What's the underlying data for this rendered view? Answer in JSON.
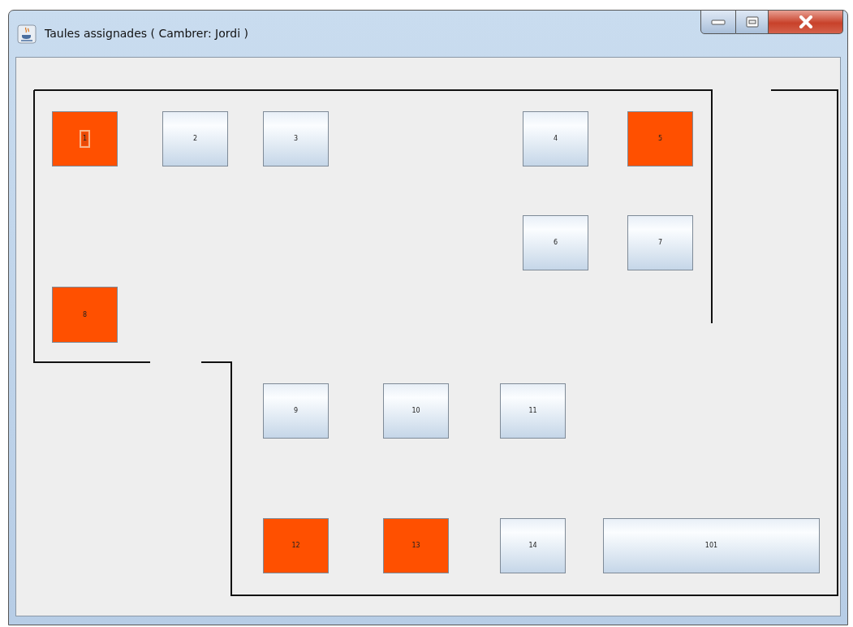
{
  "window": {
    "title": "Taules assignades ( Cambrer: Jordi )"
  },
  "tables": [
    {
      "label": "1",
      "occupied": true,
      "focused": true
    },
    {
      "label": "2",
      "occupied": false,
      "focused": false
    },
    {
      "label": "3",
      "occupied": false,
      "focused": false
    },
    {
      "label": "4",
      "occupied": false,
      "focused": false
    },
    {
      "label": "5",
      "occupied": true,
      "focused": false
    },
    {
      "label": "6",
      "occupied": false,
      "focused": false
    },
    {
      "label": "7",
      "occupied": false,
      "focused": false
    },
    {
      "label": "8",
      "occupied": true,
      "focused": false
    },
    {
      "label": "9",
      "occupied": false,
      "focused": false
    },
    {
      "label": "10",
      "occupied": false,
      "focused": false
    },
    {
      "label": "11",
      "occupied": false,
      "focused": false
    },
    {
      "label": "12",
      "occupied": true,
      "focused": false
    },
    {
      "label": "13",
      "occupied": true,
      "focused": false
    },
    {
      "label": "14",
      "occupied": false,
      "focused": false
    },
    {
      "label": "101",
      "occupied": false,
      "focused": false
    }
  ]
}
